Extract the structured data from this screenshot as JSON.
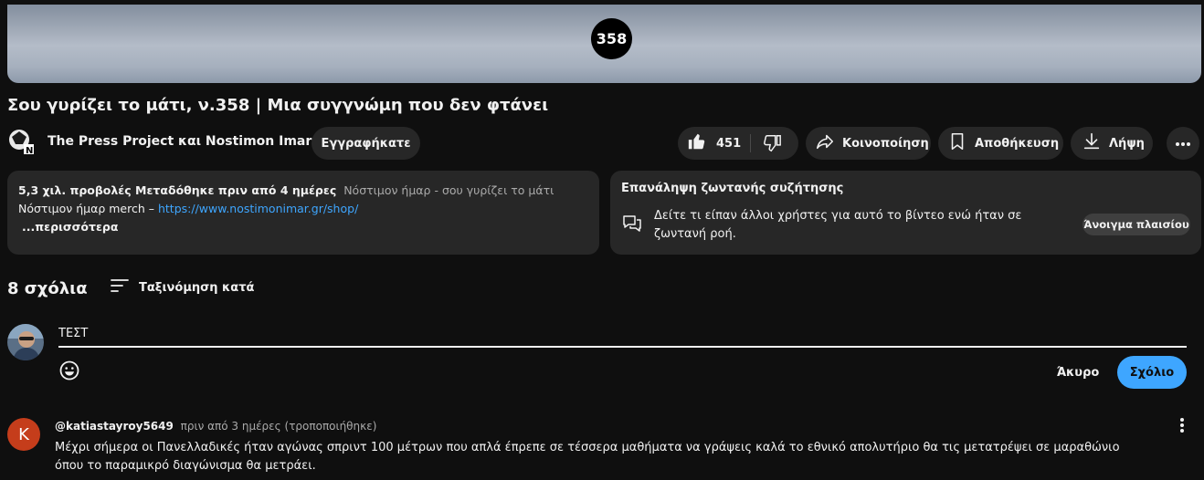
{
  "video": {
    "badge": "358",
    "title": "Σου γυρίζει το μάτι, ν.358 | Μια συγγνώμη που δεν φτάνει"
  },
  "channel": {
    "name": "The Press Project και Nostimon Imar",
    "subscribe_label": "Εγγραφήκατε"
  },
  "actions": {
    "like_count": "451",
    "share_label": "Κοινοποίηση",
    "save_label": "Αποθήκευση",
    "download_label": "Λήψη"
  },
  "description": {
    "meta": "5,3 χιλ. προβολές  Μεταδόθηκε πριν από 4 ημέρες",
    "hashtags": "Νόστιμον ήμαρ - σου γυρίζει το μάτι",
    "merch_text": "Νόστιμον ήμαρ merch – ",
    "merch_link": "https://www.nostimonimar.gr/shop/",
    "more": "...περισσότερα"
  },
  "live_chat": {
    "title": "Επανάληψη ζωντανής συζήτησης",
    "text": "Δείτε τι είπαν άλλοι χρήστες για αυτό το βίντεο ενώ ήταν σε ζωντανή ροή.",
    "open_label": "Άνοιγμα πλαισίου"
  },
  "comments": {
    "count_label": "8 σχόλια",
    "sort_label": "Ταξινόμηση κατά",
    "input_value": "ΤΕΣΤ",
    "cancel_label": "Άκυρο",
    "submit_label": "Σχόλιο",
    "items": [
      {
        "avatar_letter": "K",
        "author": "@katiastayroy5649",
        "date": "πριν από 3 ημέρες (τροποποιήθηκε)",
        "text": "Μέχρι σήμερα οι Πανελλαδικές ήταν αγώνας σπριντ 100 μέτρων που απλά έπρεπε σε τέσσερα μαθήματα να γράψεις καλά το εθνικό απολυτήριο θα τις μετατρέψει σε μαραθώνιο όπου το παραμικρό διαγώνισμα θα μετράει."
      }
    ]
  },
  "colors": {
    "background": "#0f0f0f",
    "surface": "#272727",
    "accent": "#3ea6ff",
    "avatar_k": "#c53d1b"
  }
}
